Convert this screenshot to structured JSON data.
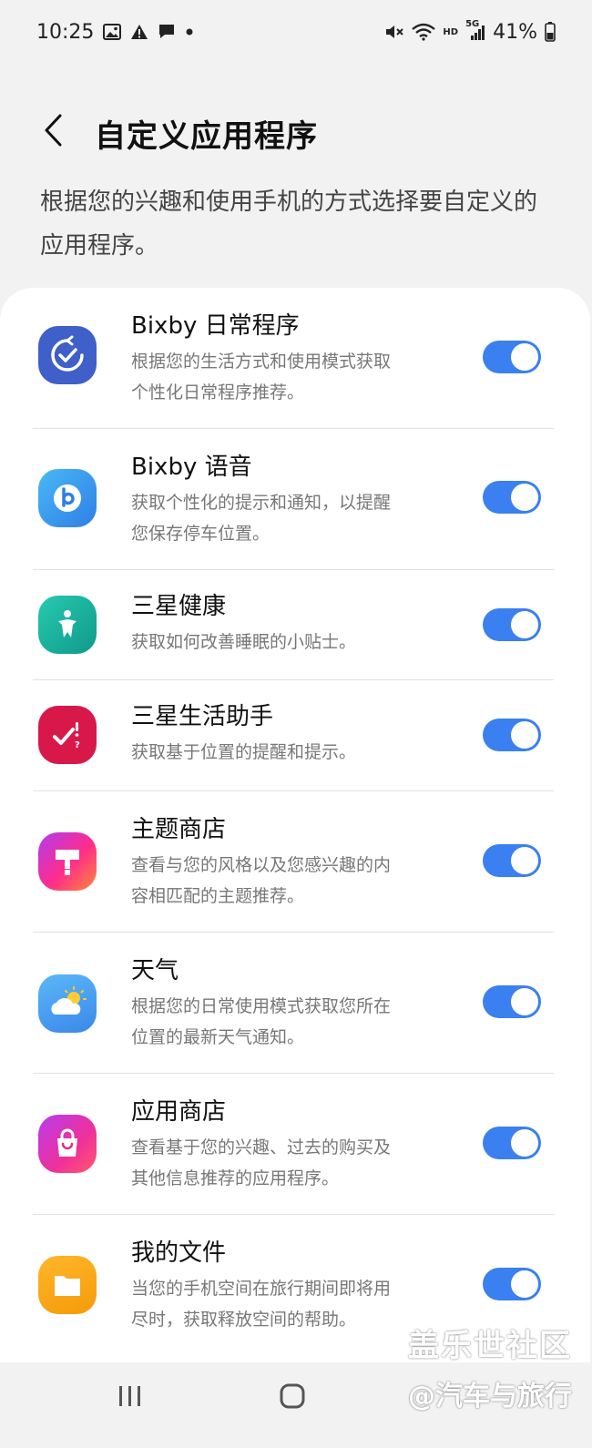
{
  "status_bar": {
    "time": "10:25",
    "left_icons": [
      "image-icon",
      "warning-icon",
      "chat-bubble-icon",
      "dot-icon"
    ],
    "right_icons": [
      "mute-icon",
      "wifi-icon",
      "hd-icon",
      "5g-signal-icon",
      "battery-icon"
    ],
    "hd_label": "HD",
    "network_label": "5G",
    "battery_percent": "41%"
  },
  "header": {
    "title": "自定义应用程序",
    "back_icon": "chevron-left-icon"
  },
  "description": "根据您的兴趣和使用手机的方式选择要自定义的应用程序。",
  "apps": [
    {
      "name": "Bixby 日常程序",
      "desc_line1": "根据您的生活方式和使用模式获取",
      "desc_line2": "个性化日常程序推荐。",
      "icon": "bixby-routines-icon",
      "icon_color": "#3f5fc9",
      "enabled": true
    },
    {
      "name": "Bixby 语音",
      "desc_line1": "获取个性化的提示和通知，以提醒",
      "desc_line2": "您保存停车位置。",
      "icon": "bixby-voice-icon",
      "icon_color": "#3da4f2",
      "enabled": true
    },
    {
      "name": "三星健康",
      "desc_line1": "获取如何改善睡眠的小贴士。",
      "desc_line2": "",
      "icon": "samsung-health-icon",
      "icon_color": "#15b59a",
      "enabled": true
    },
    {
      "name": "三星生活助手",
      "desc_line1": "获取基于位置的提醒和提示。",
      "desc_line2": "",
      "icon": "reminder-icon",
      "icon_color": "#d9184a",
      "enabled": true
    },
    {
      "name": "主题商店",
      "desc_line1": "查看与您的风格以及您感兴趣的内",
      "desc_line2": "容相匹配的主题推荐。",
      "icon": "theme-store-icon",
      "icon_color": "#e8307a",
      "enabled": true
    },
    {
      "name": "天气",
      "desc_line1": "根据您的日常使用模式获取您所在",
      "desc_line2": "位置的最新天气通知。",
      "icon": "weather-icon",
      "icon_color": "#4aa3f0",
      "enabled": true
    },
    {
      "name": "应用商店",
      "desc_line1": "查看基于您的兴趣、过去的购买及",
      "desc_line2": "其他信息推荐的应用程序。",
      "icon": "galaxy-store-icon",
      "icon_color": "#d93aa0",
      "enabled": true
    },
    {
      "name": "我的文件",
      "desc_line1": "当您的手机空间在旅行期间即将用",
      "desc_line2": "尽时，获取释放空间的帮助。",
      "icon": "my-files-icon",
      "icon_color": "#f5a60f",
      "enabled": true
    }
  ],
  "nav_bar": {
    "recents_icon": "recents-icon",
    "home_icon": "home-icon"
  },
  "watermark": {
    "line1": "盖乐世社区",
    "line2": "@汽车与旅行"
  },
  "colors": {
    "accent": "#3a80f0",
    "background": "#f2f2f2",
    "card": "#ffffff"
  }
}
